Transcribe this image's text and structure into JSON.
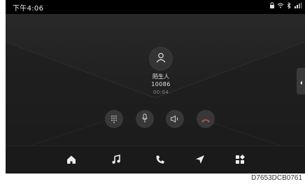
{
  "status_bar": {
    "time": "下午4:06",
    "icons": [
      "lock-icon",
      "wifi-icon",
      "bluetooth-icon",
      "signal-icon"
    ]
  },
  "call": {
    "caller_name": "陌生人",
    "caller_number": "10086",
    "duration": "00:04"
  },
  "controls": [
    {
      "name": "keypad-button",
      "icon": "keypad-icon"
    },
    {
      "name": "microphone-button",
      "icon": "microphone-icon"
    },
    {
      "name": "speaker-button",
      "icon": "speaker-icon"
    },
    {
      "name": "hang-up-button",
      "icon": "hang-up-icon"
    }
  ],
  "bottom_nav": [
    "home-icon",
    "music-icon",
    "phone-icon",
    "navigation-icon",
    "apps-icon"
  ],
  "caption": "D7653DCB0761",
  "colors": {
    "screen_bg": "#222222",
    "status_bar": "#000000",
    "hang_up": "#c05a3c",
    "text": "#e6e6e6"
  }
}
